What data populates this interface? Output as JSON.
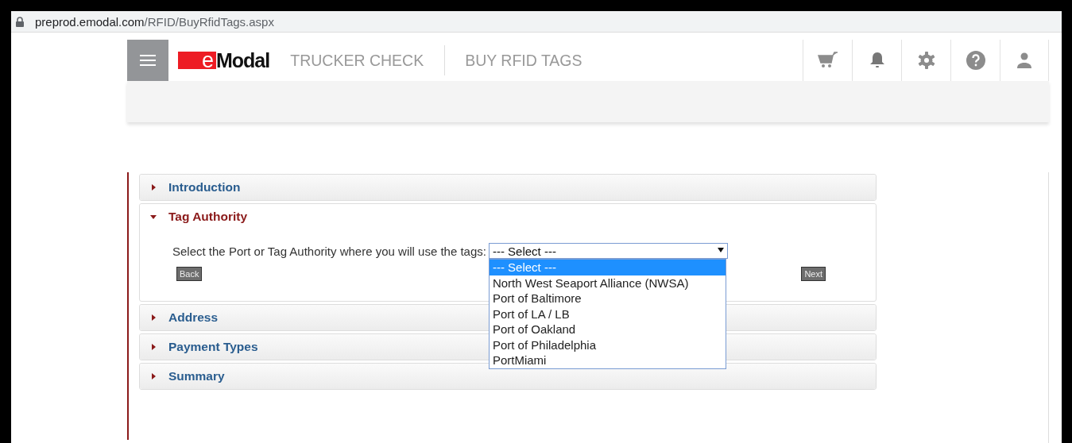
{
  "browser": {
    "url_host": "preprod.emodal.com",
    "url_path": "/RFID/BuyRfidTags.aspx"
  },
  "header": {
    "logo": {
      "mark": "e",
      "text": "Modal"
    },
    "nav": [
      {
        "label": "TRUCKER CHECK"
      },
      {
        "label": "BUY RFID TAGS"
      }
    ],
    "icons": [
      {
        "kind": "cart"
      },
      {
        "kind": "bell"
      },
      {
        "kind": "gear"
      },
      {
        "kind": "help"
      },
      {
        "kind": "user"
      }
    ]
  },
  "sections": [
    {
      "title": "Introduction",
      "expanded": false
    },
    {
      "title": "Tag Authority",
      "expanded": true,
      "body": {
        "label": "Select the Port or Tag Authority where you will use the tags:",
        "select": {
          "value": "--- Select ---",
          "open": true,
          "options": [
            {
              "label": "--- Select ---",
              "selected": true
            },
            {
              "label": "North West Seaport Alliance (NWSA)",
              "selected": false
            },
            {
              "label": "Port of Baltimore",
              "selected": false
            },
            {
              "label": "Port of LA / LB",
              "selected": false
            },
            {
              "label": "Port of Oakland",
              "selected": false
            },
            {
              "label": "Port of Philadelphia",
              "selected": false
            },
            {
              "label": "PortMiami",
              "selected": false
            }
          ]
        },
        "buttons": [
          {
            "label": "Back"
          },
          {
            "label": "Next"
          }
        ]
      }
    },
    {
      "title": "Address",
      "expanded": false
    },
    {
      "title": "Payment Types",
      "expanded": false
    },
    {
      "title": "Summary",
      "expanded": false
    }
  ]
}
